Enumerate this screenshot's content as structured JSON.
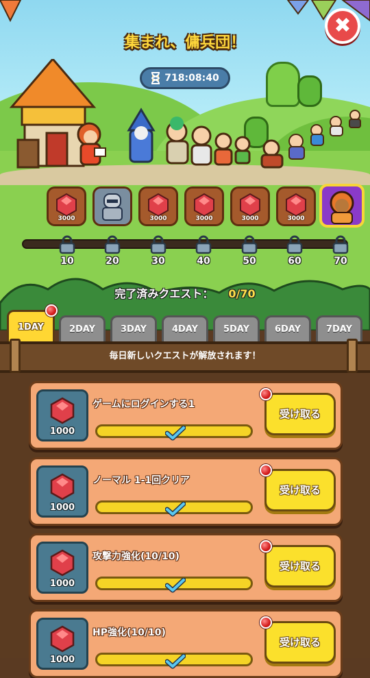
{
  "header": {
    "title": "集まれ、傭兵団！",
    "timer": "718:08:40",
    "close_icon": "close-icon"
  },
  "rewards": [
    {
      "type": "gem",
      "amount": "3000"
    },
    {
      "type": "hero-knight"
    },
    {
      "type": "gem",
      "amount": "3000"
    },
    {
      "type": "gem",
      "amount": "3000"
    },
    {
      "type": "gem",
      "amount": "3000"
    },
    {
      "type": "gem",
      "amount": "3000"
    },
    {
      "type": "hero-purple"
    }
  ],
  "milestones": [
    "10",
    "20",
    "30",
    "40",
    "50",
    "60",
    "70"
  ],
  "progress": {
    "label": "完了済みクエスト：",
    "value": "0/70",
    "fraction": 0
  },
  "tabs": [
    {
      "label": "1DAY",
      "active": true,
      "notify": true
    },
    {
      "label": "2DAY"
    },
    {
      "label": "3DAY"
    },
    {
      "label": "4DAY"
    },
    {
      "label": "5DAY"
    },
    {
      "label": "6DAY"
    },
    {
      "label": "7DAY"
    }
  ],
  "banner": "毎日新しいクエストが解放されます！",
  "quests": [
    {
      "title": "ゲームにログインする1",
      "reward": "1000",
      "button": "受け取る",
      "complete": true
    },
    {
      "title": "ノーマル 1-1回クリア",
      "reward": "1000",
      "button": "受け取る",
      "complete": true
    },
    {
      "title": "攻撃力強化(10/10)",
      "reward": "1000",
      "button": "受け取る",
      "complete": true
    },
    {
      "title": "HP強化(10/10)",
      "reward": "1000",
      "button": "受け取る",
      "complete": true
    }
  ],
  "colors": {
    "gem": "#e0404a",
    "accent": "#ffd733",
    "card": "#f4a876"
  }
}
